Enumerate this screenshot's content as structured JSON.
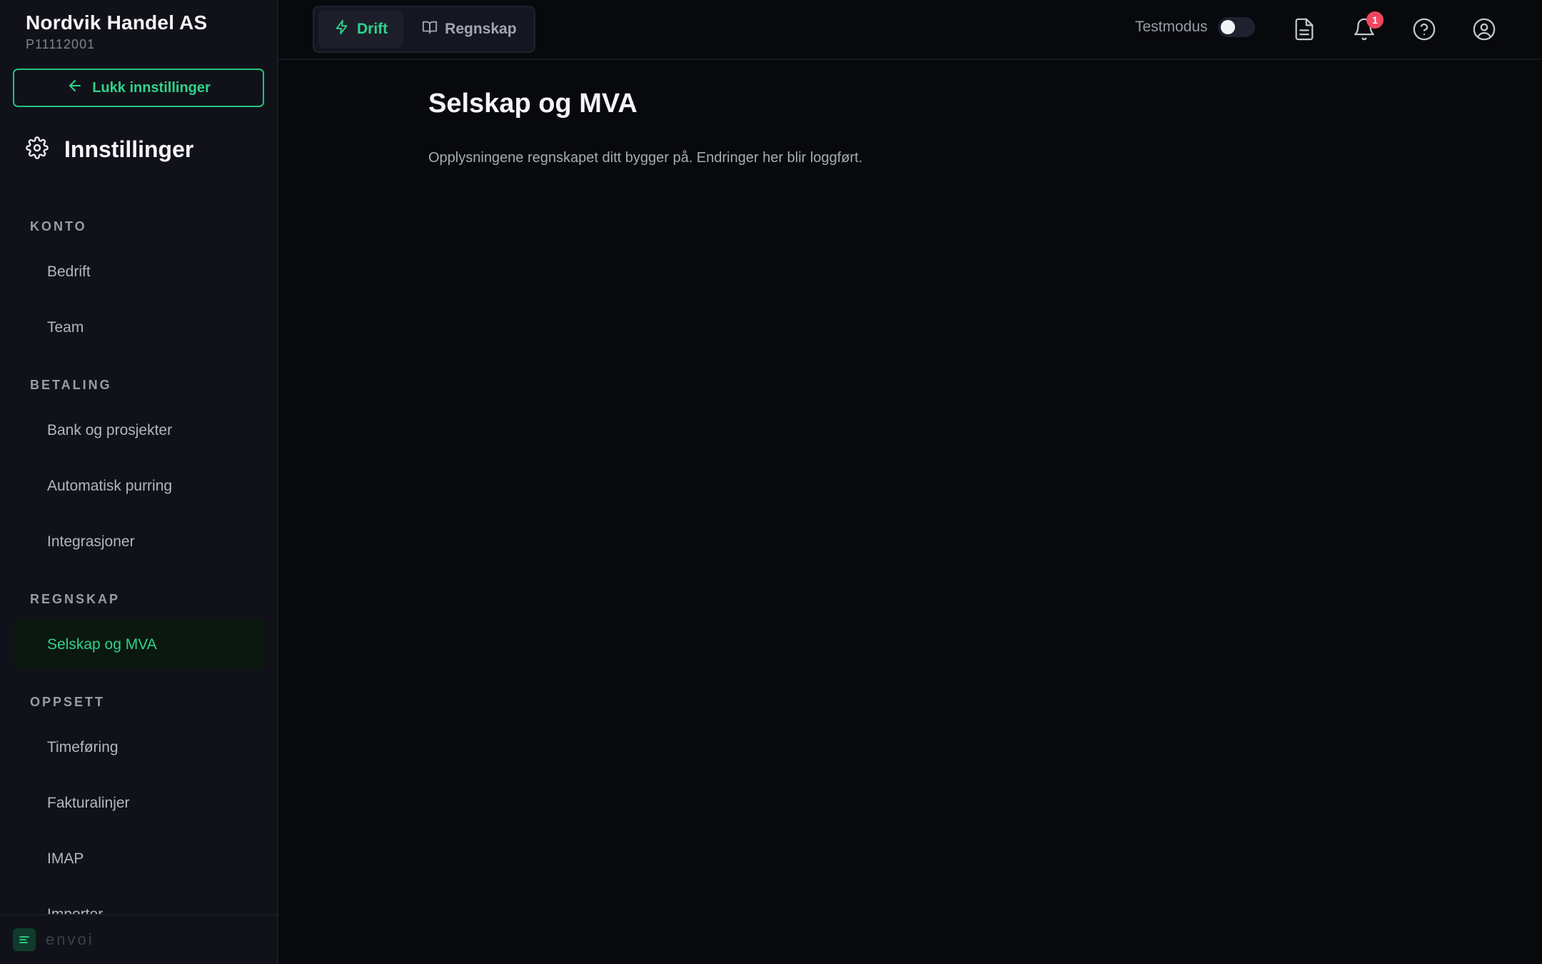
{
  "company": {
    "name": "Nordvik Handel AS",
    "id": "P11112001"
  },
  "sidebar": {
    "close_label": "Lukk innstillinger",
    "title": "Innstillinger",
    "sections": [
      {
        "label": "KONTO",
        "items": [
          {
            "label": "Bedrift"
          },
          {
            "label": "Team"
          }
        ]
      },
      {
        "label": "BETALING",
        "items": [
          {
            "label": "Bank og prosjekter"
          },
          {
            "label": "Automatisk purring"
          },
          {
            "label": "Integrasjoner"
          }
        ]
      },
      {
        "label": "REGNSKAP",
        "items": [
          {
            "label": "Selskap og MVA",
            "active": true
          }
        ]
      },
      {
        "label": "OPPSETT",
        "items": [
          {
            "label": "Timeføring"
          },
          {
            "label": "Fakturalinjer"
          },
          {
            "label": "IMAP"
          },
          {
            "label": "Importer"
          }
        ]
      }
    ],
    "footer_brand": "envoi"
  },
  "topbar": {
    "tabs": [
      {
        "label": "Drift",
        "active": true
      },
      {
        "label": "Regnskap"
      }
    ],
    "testmode_label": "Testmodus",
    "testmode_on": false,
    "notification_count": "1"
  },
  "main": {
    "title": "Selskap og MVA",
    "description": "Opplysningene regnskapet ditt bygger på. Endringer her blir loggført."
  },
  "colors": {
    "accent": "#2fd48a",
    "background": "#08090d",
    "sidebar": "#111219",
    "badge": "#f0465e"
  }
}
